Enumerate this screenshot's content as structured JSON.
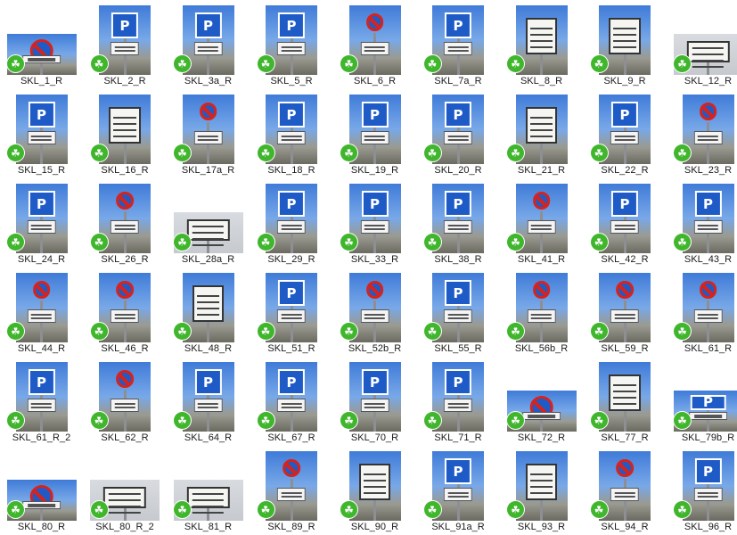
{
  "share_glyph": "☘",
  "files": [
    {
      "label": "SKL_1_R",
      "sign": "no",
      "shape": "wide"
    },
    {
      "label": "SKL_2_R",
      "sign": "p",
      "shape": "tall"
    },
    {
      "label": "SKL_3a_R",
      "sign": "p",
      "shape": "tall"
    },
    {
      "label": "SKL_5_R",
      "sign": "p",
      "shape": "tall"
    },
    {
      "label": "SKL_6_R",
      "sign": "no",
      "shape": "tall"
    },
    {
      "label": "SKL_7a_R",
      "sign": "p",
      "shape": "tall"
    },
    {
      "label": "SKL_8_R",
      "sign": "text",
      "shape": "tall"
    },
    {
      "label": "SKL_9_R",
      "sign": "text",
      "shape": "tall"
    },
    {
      "label": "SKL_12_R",
      "sign": "text",
      "shape": "wide"
    },
    {
      "label": "SKL_15_R",
      "sign": "p",
      "shape": "tall"
    },
    {
      "label": "SKL_16_R",
      "sign": "text",
      "shape": "tall"
    },
    {
      "label": "SKL_17a_R",
      "sign": "no",
      "shape": "tall"
    },
    {
      "label": "SKL_18_R",
      "sign": "p",
      "shape": "tall"
    },
    {
      "label": "SKL_19_R",
      "sign": "p",
      "shape": "tall"
    },
    {
      "label": "SKL_20_R",
      "sign": "p",
      "shape": "tall"
    },
    {
      "label": "SKL_21_R",
      "sign": "text",
      "shape": "tall"
    },
    {
      "label": "SKL_22_R",
      "sign": "p",
      "shape": "tall"
    },
    {
      "label": "SKL_23_R",
      "sign": "no",
      "shape": "tall"
    },
    {
      "label": "SKL_24_R",
      "sign": "p",
      "shape": "tall"
    },
    {
      "label": "SKL_26_R",
      "sign": "no",
      "shape": "tall"
    },
    {
      "label": "SKL_28a_R",
      "sign": "text",
      "shape": "wide"
    },
    {
      "label": "SKL_29_R",
      "sign": "p",
      "shape": "tall"
    },
    {
      "label": "SKL_33_R",
      "sign": "p",
      "shape": "tall"
    },
    {
      "label": "SKL_38_R",
      "sign": "p",
      "shape": "tall"
    },
    {
      "label": "SKL_41_R",
      "sign": "no",
      "shape": "tall"
    },
    {
      "label": "SKL_42_R",
      "sign": "p",
      "shape": "tall"
    },
    {
      "label": "SKL_43_R",
      "sign": "p",
      "shape": "tall"
    },
    {
      "label": "SKL_44_R",
      "sign": "no",
      "shape": "tall"
    },
    {
      "label": "SKL_46_R",
      "sign": "no",
      "shape": "tall"
    },
    {
      "label": "SKL_48_R",
      "sign": "text",
      "shape": "tall"
    },
    {
      "label": "SKL_51_R",
      "sign": "p",
      "shape": "tall"
    },
    {
      "label": "SKL_52b_R",
      "sign": "no",
      "shape": "tall"
    },
    {
      "label": "SKL_55_R",
      "sign": "p",
      "shape": "tall"
    },
    {
      "label": "SKL_56b_R",
      "sign": "no",
      "shape": "tall"
    },
    {
      "label": "SKL_59_R",
      "sign": "no",
      "shape": "tall"
    },
    {
      "label": "SKL_61_R",
      "sign": "no",
      "shape": "tall"
    },
    {
      "label": "SKL_61_R_2",
      "sign": "p",
      "shape": "tall"
    },
    {
      "label": "SKL_62_R",
      "sign": "no",
      "shape": "tall"
    },
    {
      "label": "SKL_64_R",
      "sign": "p",
      "shape": "tall"
    },
    {
      "label": "SKL_67_R",
      "sign": "p",
      "shape": "tall"
    },
    {
      "label": "SKL_70_R",
      "sign": "p",
      "shape": "tall"
    },
    {
      "label": "SKL_71_R",
      "sign": "p",
      "shape": "tall"
    },
    {
      "label": "SKL_72_R",
      "sign": "no",
      "shape": "wide"
    },
    {
      "label": "SKL_77_R",
      "sign": "text",
      "shape": "tall"
    },
    {
      "label": "SKL_79b_R",
      "sign": "p",
      "shape": "wide"
    },
    {
      "label": "SKL_80_R",
      "sign": "no",
      "shape": "wide"
    },
    {
      "label": "SKL_80_R_2",
      "sign": "text",
      "shape": "wide"
    },
    {
      "label": "SKL_81_R",
      "sign": "text",
      "shape": "wide"
    },
    {
      "label": "SKL_89_R",
      "sign": "no",
      "shape": "tall"
    },
    {
      "label": "SKL_90_R",
      "sign": "text",
      "shape": "tall"
    },
    {
      "label": "SKL_91a_R",
      "sign": "p",
      "shape": "tall"
    },
    {
      "label": "SKL_93_R",
      "sign": "text",
      "shape": "tall"
    },
    {
      "label": "SKL_94_R",
      "sign": "no",
      "shape": "tall"
    },
    {
      "label": "SKL_96_R",
      "sign": "p",
      "shape": "tall"
    }
  ]
}
